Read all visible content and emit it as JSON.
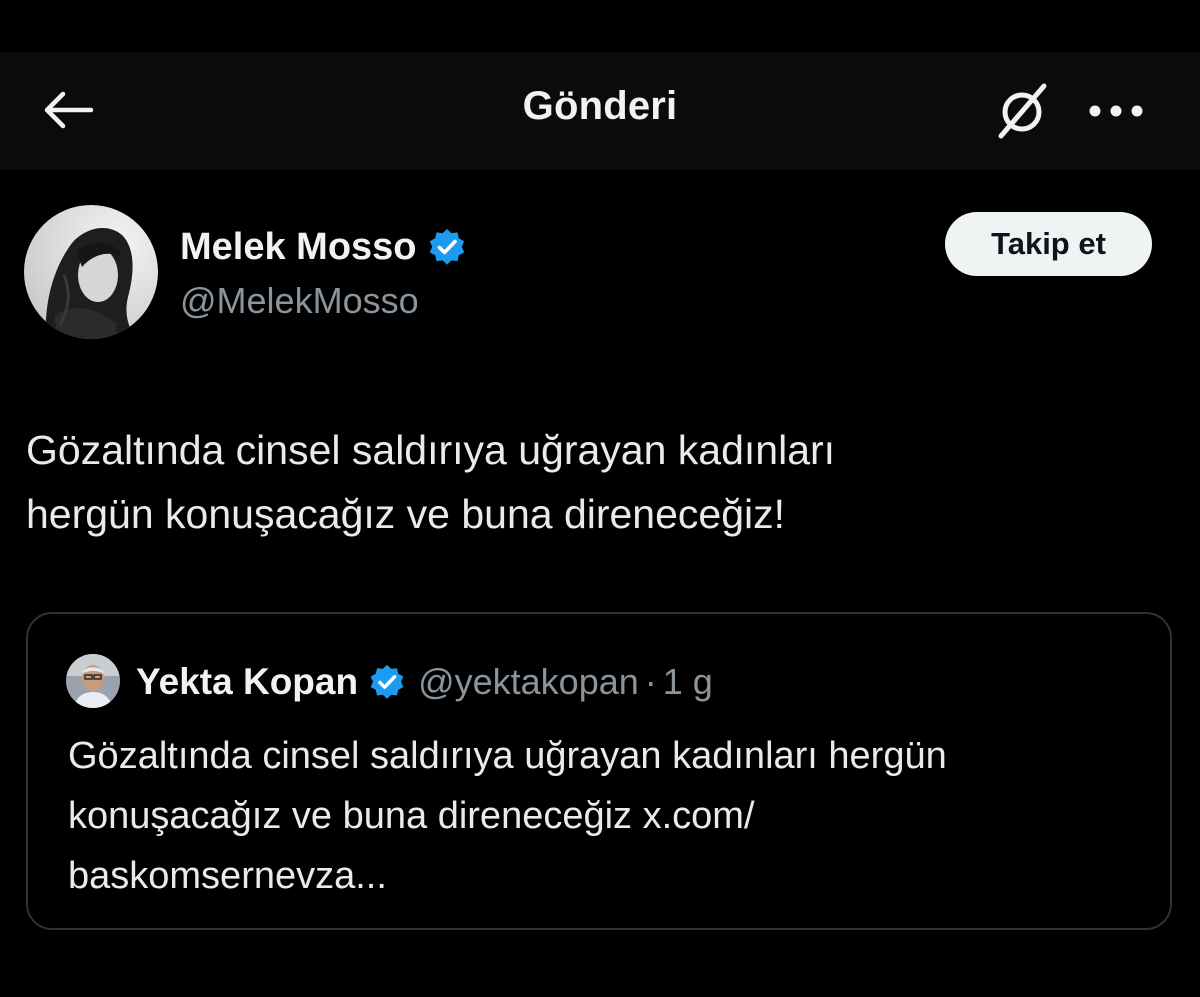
{
  "header": {
    "title": "Gönderi",
    "back_icon": "arrow-left-icon",
    "grok_icon": "grok-icon",
    "more_icon": "more-horizontal-icon"
  },
  "post": {
    "author": {
      "name": "Melek Mosso",
      "handle": "@MelekMosso",
      "verified": true
    },
    "follow_label": "Takip et",
    "text": "Gözaltında cinsel saldırıya uğrayan kadınları\nhergün konuşacağız ve buna direneceğiz!"
  },
  "quote": {
    "author": {
      "name": "Yekta Kopan",
      "handle": "@yektakopan",
      "verified": true
    },
    "separator": "·",
    "time": "1 g",
    "text": "Gözaltında cinsel saldırıya uğrayan kadınları hergün\nkonuşacağız ve buna direneceğiz x.com/\nbaskomsernevza..."
  },
  "colors": {
    "background": "#000000",
    "header_background": "#0b0b0c",
    "text_primary": "#e7e9ea",
    "text_secondary": "#8b949b",
    "verified_blue": "#1d9bf0",
    "border": "#2f3336",
    "follow_button_bg": "#eff3f4"
  }
}
